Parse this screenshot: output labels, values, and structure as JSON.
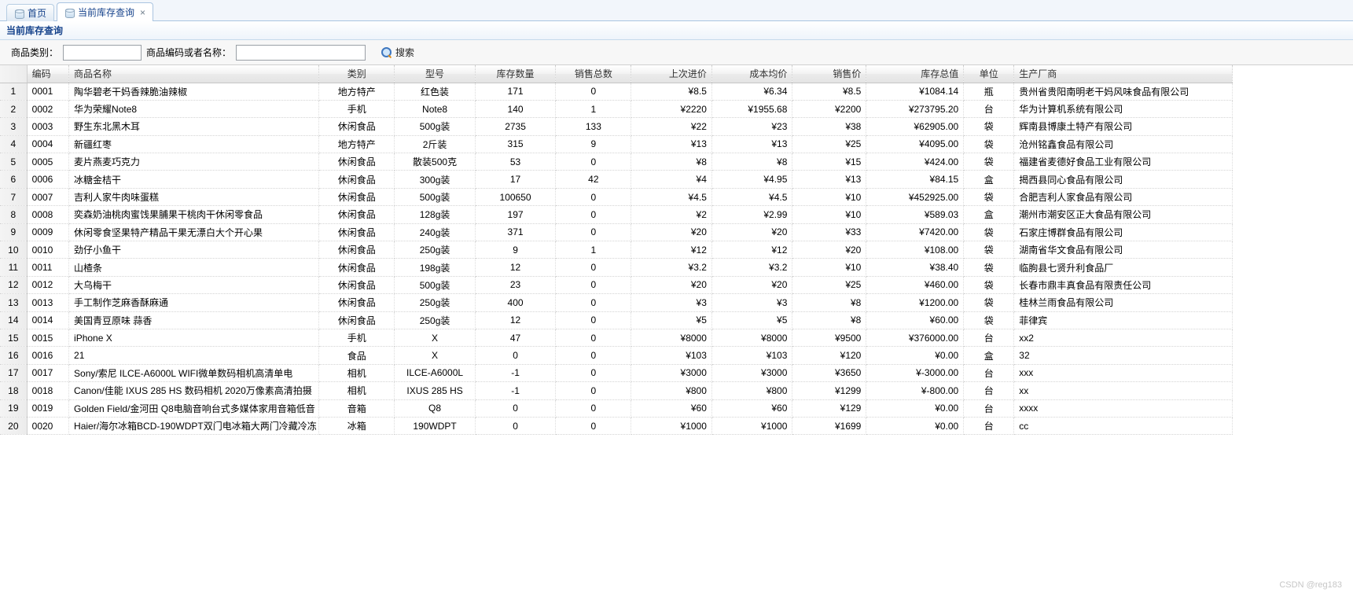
{
  "tabs": [
    {
      "label": "首页",
      "icon": "database-icon",
      "closable": false,
      "active": false
    },
    {
      "label": "当前库存查询",
      "icon": "database-icon",
      "closable": true,
      "active": true
    }
  ],
  "tab_close_glyph": "×",
  "panel": {
    "title": "当前库存查询"
  },
  "search": {
    "category_label": "商品类别：",
    "category_value": "",
    "category_placeholder": "",
    "keyword_label": "商品编码或者名称：",
    "keyword_value": "",
    "keyword_placeholder": "",
    "button_label": "搜索",
    "button_icon": "search-icon"
  },
  "grid": {
    "rownum_header": "",
    "columns": [
      {
        "key": "code",
        "label": "编码",
        "align": "c-l"
      },
      {
        "key": "name",
        "label": "商品名称",
        "align": "c-l"
      },
      {
        "key": "cat",
        "label": "类别",
        "align": "c-c"
      },
      {
        "key": "model",
        "label": "型号",
        "align": "c-c"
      },
      {
        "key": "stock",
        "label": "库存数量",
        "align": "c-c"
      },
      {
        "key": "sales",
        "label": "销售总数",
        "align": "c-c"
      },
      {
        "key": "last",
        "label": "上次进价",
        "align": "c-r"
      },
      {
        "key": "cost",
        "label": "成本均价",
        "align": "c-r"
      },
      {
        "key": "sell",
        "label": "销售价",
        "align": "c-r"
      },
      {
        "key": "total",
        "label": "库存总值",
        "align": "c-r"
      },
      {
        "key": "unit",
        "label": "单位",
        "align": "c-c"
      },
      {
        "key": "mfr",
        "label": "生产厂商",
        "align": "c-l"
      }
    ],
    "rows": [
      {
        "n": "1",
        "code": "0001",
        "name": "陶华碧老干妈香辣脆油辣椒",
        "cat": "地方特产",
        "model": "红色装",
        "stock": "171",
        "sales": "0",
        "last": "¥8.5",
        "cost": "¥6.34",
        "sell": "¥8.5",
        "total": "¥1084.14",
        "unit": "瓶",
        "mfr": "贵州省贵阳南明老干妈风味食品有限公司"
      },
      {
        "n": "2",
        "code": "0002",
        "name": "华为荣耀Note8",
        "cat": "手机",
        "model": "Note8",
        "stock": "140",
        "sales": "1",
        "last": "¥2220",
        "cost": "¥1955.68",
        "sell": "¥2200",
        "total": "¥273795.20",
        "unit": "台",
        "mfr": "华为计算机系统有限公司"
      },
      {
        "n": "3",
        "code": "0003",
        "name": "野生东北黑木耳",
        "cat": "休闲食品",
        "model": "500g装",
        "stock": "2735",
        "sales": "133",
        "last": "¥22",
        "cost": "¥23",
        "sell": "¥38",
        "total": "¥62905.00",
        "unit": "袋",
        "mfr": "辉南县博康土特产有限公司"
      },
      {
        "n": "4",
        "code": "0004",
        "name": "新疆红枣",
        "cat": "地方特产",
        "model": "2斤装",
        "stock": "315",
        "sales": "9",
        "last": "¥13",
        "cost": "¥13",
        "sell": "¥25",
        "total": "¥4095.00",
        "unit": "袋",
        "mfr": "沧州铭鑫食品有限公司"
      },
      {
        "n": "5",
        "code": "0005",
        "name": "麦片燕麦巧克力",
        "cat": "休闲食品",
        "model": "散装500克",
        "stock": "53",
        "sales": "0",
        "last": "¥8",
        "cost": "¥8",
        "sell": "¥15",
        "total": "¥424.00",
        "unit": "袋",
        "mfr": "福建省麦德好食品工业有限公司"
      },
      {
        "n": "6",
        "code": "0006",
        "name": "冰糖金桔干",
        "cat": "休闲食品",
        "model": "300g装",
        "stock": "17",
        "sales": "42",
        "last": "¥4",
        "cost": "¥4.95",
        "sell": "¥13",
        "total": "¥84.15",
        "unit": "盒",
        "mfr": "揭西县同心食品有限公司"
      },
      {
        "n": "7",
        "code": "0007",
        "name": "吉利人家牛肉味蛋糕",
        "cat": "休闲食品",
        "model": "500g装",
        "stock": "100650",
        "sales": "0",
        "last": "¥4.5",
        "cost": "¥4.5",
        "sell": "¥10",
        "total": "¥452925.00",
        "unit": "袋",
        "mfr": "合肥吉利人家食品有限公司"
      },
      {
        "n": "8",
        "code": "0008",
        "name": "奕森奶油桃肉蜜饯果脯果干桃肉干休闲零食品",
        "cat": "休闲食品",
        "model": "128g装",
        "stock": "197",
        "sales": "0",
        "last": "¥2",
        "cost": "¥2.99",
        "sell": "¥10",
        "total": "¥589.03",
        "unit": "盒",
        "mfr": "潮州市潮安区正大食品有限公司"
      },
      {
        "n": "9",
        "code": "0009",
        "name": "休闲零食坚果特产精品干果无漂白大个开心果",
        "cat": "休闲食品",
        "model": "240g装",
        "stock": "371",
        "sales": "0",
        "last": "¥20",
        "cost": "¥20",
        "sell": "¥33",
        "total": "¥7420.00",
        "unit": "袋",
        "mfr": "石家庄博群食品有限公司"
      },
      {
        "n": "10",
        "code": "0010",
        "name": "劲仔小鱼干",
        "cat": "休闲食品",
        "model": "250g装",
        "stock": "9",
        "sales": "1",
        "last": "¥12",
        "cost": "¥12",
        "sell": "¥20",
        "total": "¥108.00",
        "unit": "袋",
        "mfr": "湖南省华文食品有限公司"
      },
      {
        "n": "11",
        "code": "0011",
        "name": "山楂条",
        "cat": "休闲食品",
        "model": "198g装",
        "stock": "12",
        "sales": "0",
        "last": "¥3.2",
        "cost": "¥3.2",
        "sell": "¥10",
        "total": "¥38.40",
        "unit": "袋",
        "mfr": "临朐县七贤升利食品厂"
      },
      {
        "n": "12",
        "code": "0012",
        "name": "大乌梅干",
        "cat": "休闲食品",
        "model": "500g装",
        "stock": "23",
        "sales": "0",
        "last": "¥20",
        "cost": "¥20",
        "sell": "¥25",
        "total": "¥460.00",
        "unit": "袋",
        "mfr": "长春市鼎丰真食品有限责任公司"
      },
      {
        "n": "13",
        "code": "0013",
        "name": "手工制作芝麻香酥麻通",
        "cat": "休闲食品",
        "model": "250g装",
        "stock": "400",
        "sales": "0",
        "last": "¥3",
        "cost": "¥3",
        "sell": "¥8",
        "total": "¥1200.00",
        "unit": "袋",
        "mfr": "桂林兰雨食品有限公司"
      },
      {
        "n": "14",
        "code": "0014",
        "name": "美国青豆原味 蒜香",
        "cat": "休闲食品",
        "model": "250g装",
        "stock": "12",
        "sales": "0",
        "last": "¥5",
        "cost": "¥5",
        "sell": "¥8",
        "total": "¥60.00",
        "unit": "袋",
        "mfr": "菲律宾"
      },
      {
        "n": "15",
        "code": "0015",
        "name": "iPhone X",
        "cat": "手机",
        "model": "X",
        "stock": "47",
        "sales": "0",
        "last": "¥8000",
        "cost": "¥8000",
        "sell": "¥9500",
        "total": "¥376000.00",
        "unit": "台",
        "mfr": "xx2"
      },
      {
        "n": "16",
        "code": "0016",
        "name": "21",
        "cat": "食品",
        "model": "X",
        "stock": "0",
        "sales": "0",
        "last": "¥103",
        "cost": "¥103",
        "sell": "¥120",
        "total": "¥0.00",
        "unit": "盒",
        "mfr": "32"
      },
      {
        "n": "17",
        "code": "0017",
        "name": "Sony/索尼 ILCE-A6000L WIFI微单数码相机高清单电",
        "cat": "相机",
        "model": "ILCE-A6000L",
        "stock": "-1",
        "sales": "0",
        "last": "¥3000",
        "cost": "¥3000",
        "sell": "¥3650",
        "total": "¥-3000.00",
        "unit": "台",
        "mfr": "xxx"
      },
      {
        "n": "18",
        "code": "0018",
        "name": "Canon/佳能 IXUS 285 HS 数码相机 2020万像素高清拍摄",
        "cat": "相机",
        "model": "IXUS 285 HS",
        "stock": "-1",
        "sales": "0",
        "last": "¥800",
        "cost": "¥800",
        "sell": "¥1299",
        "total": "¥-800.00",
        "unit": "台",
        "mfr": "xx"
      },
      {
        "n": "19",
        "code": "0019",
        "name": "Golden Field/金河田 Q8电脑音响台式多媒体家用音箱低音",
        "cat": "音箱",
        "model": "Q8",
        "stock": "0",
        "sales": "0",
        "last": "¥60",
        "cost": "¥60",
        "sell": "¥129",
        "total": "¥0.00",
        "unit": "台",
        "mfr": "xxxx"
      },
      {
        "n": "20",
        "code": "0020",
        "name": "Haier/海尔冰箱BCD-190WDPT双门电冰箱大两门冷藏冷冻",
        "cat": "冰箱",
        "model": "190WDPT",
        "stock": "0",
        "sales": "0",
        "last": "¥1000",
        "cost": "¥1000",
        "sell": "¥1699",
        "total": "¥0.00",
        "unit": "台",
        "mfr": "cc"
      }
    ]
  },
  "watermark": "CSDN @reg183",
  "colors": {
    "accent": "#15428b",
    "tab_border": "#aac4e0",
    "header_bg": "#ebebeb"
  }
}
